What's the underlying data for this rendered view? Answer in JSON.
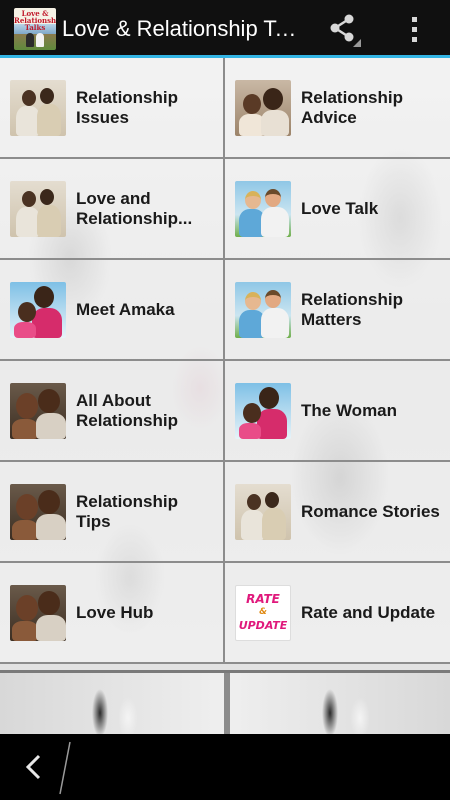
{
  "app": {
    "title": "Love & Relationship Talks",
    "icon_text": "Love & Relationship Talks"
  },
  "actionbar": {
    "share_icon": "share-icon",
    "overflow_icon": "overflow-menu-icon"
  },
  "colors": {
    "actionbar_bg": "#101010",
    "accent": "#33b5e5",
    "tile_text": "#1a1a1a",
    "rate_pink": "#e0197c",
    "rate_orange": "#e08a14"
  },
  "menu": {
    "items": [
      {
        "label": "Relationship Issues",
        "thumb": "couple-photo"
      },
      {
        "label": "Relationship Advice",
        "thumb": "couple-photo"
      },
      {
        "label": "Love and Relationship...",
        "thumb": "couple-photo"
      },
      {
        "label": "Love Talk",
        "thumb": "couple-photo"
      },
      {
        "label": "Meet Amaka",
        "thumb": "couple-photo"
      },
      {
        "label": "Relationship Matters",
        "thumb": "couple-photo"
      },
      {
        "label": "All About Relationship",
        "thumb": "couple-photo"
      },
      {
        "label": "The Woman",
        "thumb": "couple-photo"
      },
      {
        "label": "Relationship Tips",
        "thumb": "couple-photo"
      },
      {
        "label": "Romance Stories",
        "thumb": "couple-photo"
      },
      {
        "label": "Love Hub",
        "thumb": "couple-photo"
      },
      {
        "label": "Rate and Update",
        "thumb": "rate-update-badge"
      }
    ]
  },
  "rate_badge": {
    "line1": "RATE",
    "line2": "&",
    "line3": "UPDATE"
  },
  "navbar": {
    "back_icon": "back-arrow-icon"
  }
}
